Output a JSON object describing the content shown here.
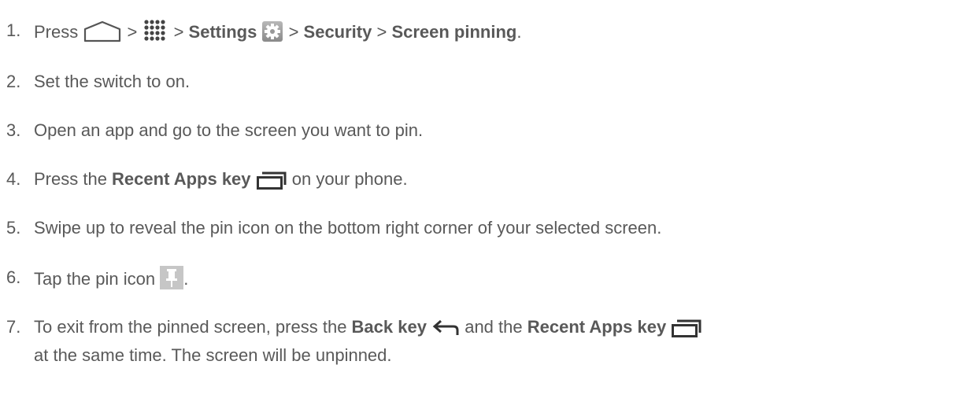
{
  "steps": [
    {
      "number": "1.",
      "press": "Press",
      "sep1": " > ",
      "sep2": " > ",
      "settings": "Settings",
      "sep3": " > ",
      "security": "Security",
      "sep4": " > ",
      "screen_pinning": "Screen pinning",
      "end": ".",
      "icons": [
        "home-icon",
        "apps-grid-icon",
        "settings-gear-icon"
      ]
    },
    {
      "number": "2.",
      "text": "Set the switch to on."
    },
    {
      "number": "3.",
      "text": "Open an app and go to the screen you want to pin."
    },
    {
      "number": "4.",
      "pre": "Press the ",
      "bold": "Recent Apps key",
      "post": " on your phone.",
      "icons": [
        "recent-apps-icon"
      ]
    },
    {
      "number": "5.",
      "text": "Swipe up to reveal the pin icon on the bottom right corner of your selected screen."
    },
    {
      "number": "6.",
      "pre": "Tap the pin icon ",
      "post": ".",
      "icons": [
        "pin-icon"
      ]
    },
    {
      "number": "7.",
      "pre": "To exit from the pinned screen, press the ",
      "bold1": "Back key",
      "mid": " and the ",
      "bold2": "Recent Apps key",
      "line2": "at the same time. The screen will be unpinned.",
      "icons": [
        "back-arrow-icon",
        "recent-apps-icon"
      ]
    }
  ]
}
